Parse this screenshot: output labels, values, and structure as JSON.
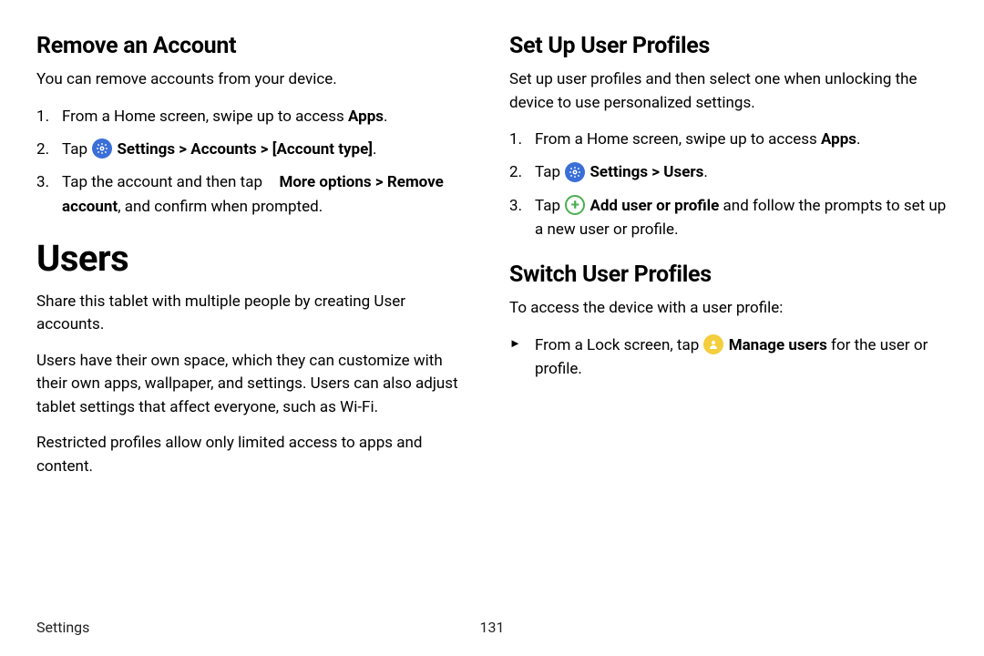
{
  "left": {
    "h_remove": "Remove an Account",
    "p_remove_intro": "You can remove accounts from your device.",
    "step1_a": "From a Home screen, swipe up to access ",
    "step1_b": "Apps",
    "step1_c": ".",
    "step2_a": "Tap ",
    "step2_b": "Settings > Accounts > [Account type]",
    "step2_c": ".",
    "step3_a": "Tap the account and then tap ",
    "step3_b": "More options > Remove account",
    "step3_c": ", and confirm when prompted.",
    "h_users": "Users",
    "p_users1": "Share this tablet with multiple people by creating User accounts.",
    "p_users2": "Users have their own space, which they can customize with their own apps, wallpaper, and settings. Users can also adjust tablet settings that affect everyone, such as Wi‑Fi.",
    "p_users3": "Restricted profiles allow only limited access to apps and content."
  },
  "right": {
    "h_setup": "Set Up User Profiles",
    "p_setup_intro": "Set up user profiles and then select one when unlocking the device to use personalized settings.",
    "s1_a": "From a Home screen, swipe up to access ",
    "s1_b": "Apps",
    "s1_c": ".",
    "s2_a": "Tap ",
    "s2_b": "Settings > Users",
    "s2_c": ".",
    "s3_a": "Tap ",
    "s3_b": "Add user or profile",
    "s3_c": " and follow the prompts to set up a new user or profile.",
    "h_switch": "Switch User Profiles",
    "p_switch_intro": "To access the device with a user profile:",
    "sw_a": "From a Lock screen, tap ",
    "sw_b": "Manage users",
    "sw_c": " for the user or profile."
  },
  "footer": {
    "section": "Settings",
    "page": "131"
  }
}
